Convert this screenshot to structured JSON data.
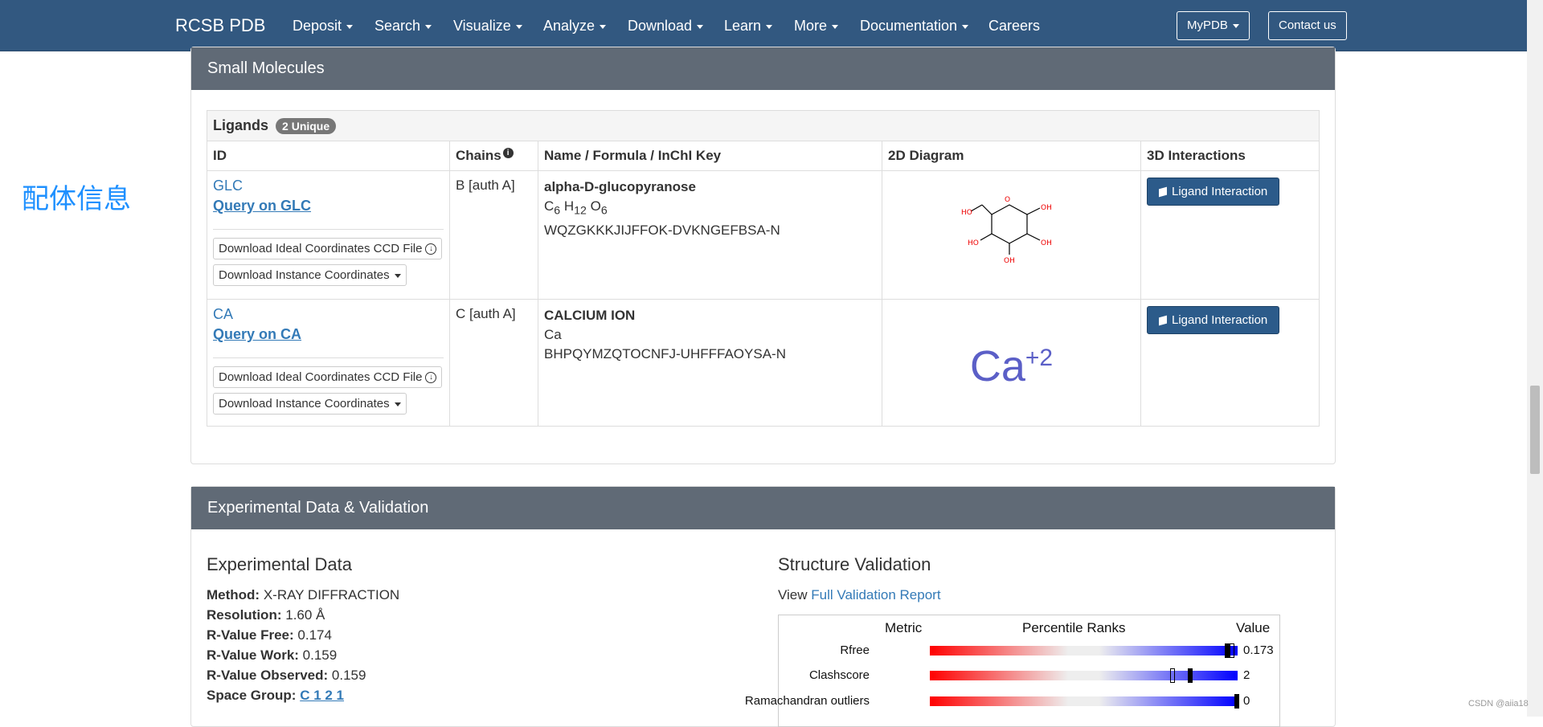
{
  "nav": {
    "brand": "RCSB PDB",
    "items": [
      {
        "label": "Deposit",
        "dropdown": true
      },
      {
        "label": "Search",
        "dropdown": true
      },
      {
        "label": "Visualize",
        "dropdown": true
      },
      {
        "label": "Analyze",
        "dropdown": true
      },
      {
        "label": "Download",
        "dropdown": true
      },
      {
        "label": "Learn",
        "dropdown": true
      },
      {
        "label": "More",
        "dropdown": true
      },
      {
        "label": "Documentation",
        "dropdown": true
      },
      {
        "label": "Careers",
        "dropdown": false
      }
    ],
    "mypdb": "MyPDB",
    "contact": "Contact us",
    "color": "#325880"
  },
  "side_note": "配体信息",
  "small_molecules": {
    "title": "Small Molecules",
    "caption": "Ligands",
    "badge": "2 Unique",
    "headers": [
      "ID",
      "Chains",
      "Name / Formula / InChI Key",
      "2D Diagram",
      "3D Interactions"
    ],
    "rows": [
      {
        "id": "GLC",
        "query": "Query on GLC",
        "dl_ideal": "Download Ideal Coordinates CCD File",
        "dl_instance": "Download Instance Coordinates",
        "chains": "B [auth A]",
        "name": "alpha-D-glucopyranose",
        "inchikey": "WQZGKKKJIJFFOK-DVKNGEFBSA-N",
        "interaction": "Ligand Interaction"
      },
      {
        "id": "CA",
        "query": "Query on CA",
        "dl_ideal": "Download Ideal Coordinates CCD File",
        "dl_instance": "Download Instance Coordinates",
        "chains": "C [auth A]",
        "name": "CALCIUM ION",
        "formula": "Ca",
        "inchikey": "BHPQYMZQTOCNFJ-UHFFFAOYSA-N",
        "diagram_symbol": "Ca",
        "diagram_charge": "+2",
        "interaction": "Ligand Interaction"
      }
    ]
  },
  "experimental": {
    "panel_title": "Experimental Data & Validation",
    "section_title": "Experimental Data",
    "method_label": "Method:",
    "method": "X-RAY DIFFRACTION",
    "resolution_label": "Resolution:",
    "resolution": "1.60 Å",
    "rfree_label": "R-Value Free:",
    "rfree": "0.174",
    "rwork_label": "R-Value Work:",
    "rwork": "0.159",
    "robs_label": "R-Value Observed:",
    "robs": "0.159",
    "sg_label": "Space Group:",
    "sg": "C 1 2 1"
  },
  "validation": {
    "title": "Structure Validation",
    "view_prefix": "View",
    "link": "Full Validation Report",
    "col_metric": "Metric",
    "col_percentile": "Percentile Ranks",
    "col_value": "Value",
    "metrics": [
      {
        "name": "Rfree",
        "value": "0.173"
      },
      {
        "name": "Clashscore",
        "value": "2"
      },
      {
        "name": "Ramachandran outliers",
        "value": "0"
      }
    ]
  },
  "watermark": "CSDN @aiia18"
}
